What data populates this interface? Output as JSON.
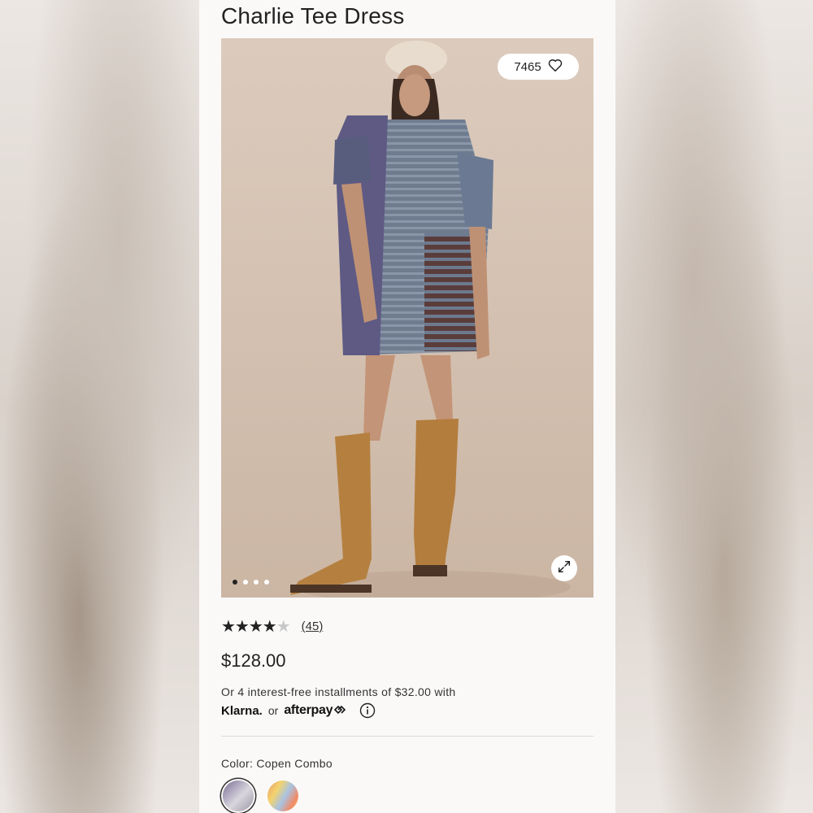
{
  "product": {
    "title": "Charlie Tee Dress",
    "likes": "7465",
    "rating_stars": 4,
    "rating_max": 5,
    "review_count": "(45)",
    "price": "$128.00",
    "installments_text": "Or 4 interest-free installments of $32.00 with",
    "klarna_label": "Klarna.",
    "or_label": "or",
    "afterpay_label": "afterpay",
    "color_label": "Color: Copen Combo"
  },
  "gallery": {
    "image_count": 4,
    "active_index": 0
  },
  "swatches": [
    {
      "name": "Copen Combo",
      "selected": true
    },
    {
      "name": "Alternate colorway",
      "selected": false
    }
  ],
  "icons": {
    "heart": "heart-icon",
    "expand": "expand-icon",
    "info": "info-icon"
  }
}
